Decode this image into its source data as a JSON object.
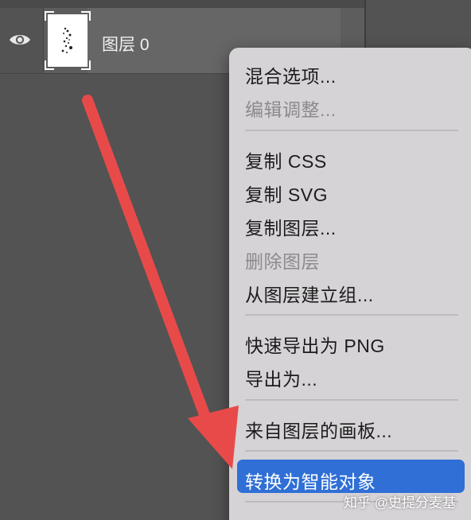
{
  "layers_panel": {
    "layer": {
      "name": "图层 0",
      "visibility_icon": "eye-icon",
      "visible": true
    }
  },
  "context_menu": {
    "items": [
      {
        "label": "混合选项...",
        "enabled": true
      },
      {
        "label": "编辑调整...",
        "enabled": false
      },
      {
        "label": "复制 CSS",
        "enabled": true
      },
      {
        "label": "复制 SVG",
        "enabled": true
      },
      {
        "label": "复制图层...",
        "enabled": true
      },
      {
        "label": "删除图层",
        "enabled": false
      },
      {
        "label": "从图层建立组...",
        "enabled": true
      },
      {
        "label": "快速导出为 PNG",
        "enabled": true
      },
      {
        "label": "导出为...",
        "enabled": true
      },
      {
        "label": "来自图层的画板...",
        "enabled": true
      },
      {
        "label": "转换为智能对象",
        "enabled": true,
        "highlighted": true
      }
    ],
    "highlight_color": "#2f6fd6"
  },
  "annotation": {
    "arrow_color": "#e84a4a"
  },
  "watermark": {
    "text": "知乎 @史提分麦基"
  }
}
